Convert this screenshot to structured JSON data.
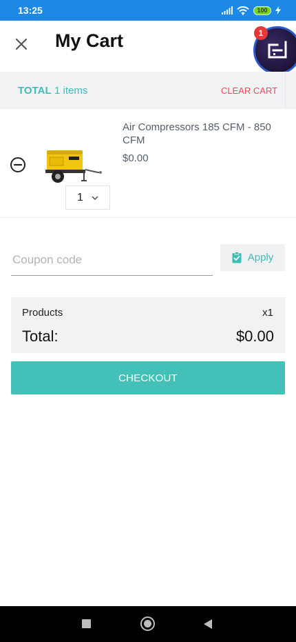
{
  "status_bar": {
    "time": "13:25",
    "battery": "100",
    "icons": [
      "signal-icon",
      "wifi-icon",
      "battery-icon",
      "charging-icon"
    ]
  },
  "header": {
    "title": "My Cart",
    "close_icon": "close-icon",
    "avatar_badge": "1",
    "avatar_icon": "brand-logo-icon"
  },
  "total_bar": {
    "label": "TOTAL",
    "items_count": "1 items",
    "clear_label": "CLEAR CART"
  },
  "cart_items": [
    {
      "name": "Air Compressors 185 CFM - 850 CFM",
      "price": "$0.00",
      "quantity": "1",
      "remove_icon": "minus-circle-icon",
      "image": "air-compressor-image"
    }
  ],
  "coupon": {
    "placeholder": "Coupon code",
    "value": "",
    "apply_label": "Apply",
    "apply_icon": "clipboard-check-icon"
  },
  "summary": {
    "products_label": "Products",
    "products_qty": "x1",
    "total_label": "Total:",
    "total_value": "$0.00"
  },
  "checkout": {
    "label": "CHECKOUT"
  },
  "colors": {
    "status_bar": "#1e88e5",
    "accent": "#43c1b8",
    "clear_cart": "#e94b5a",
    "badge": "#e53935",
    "panel_bg": "#f1f2f4"
  }
}
